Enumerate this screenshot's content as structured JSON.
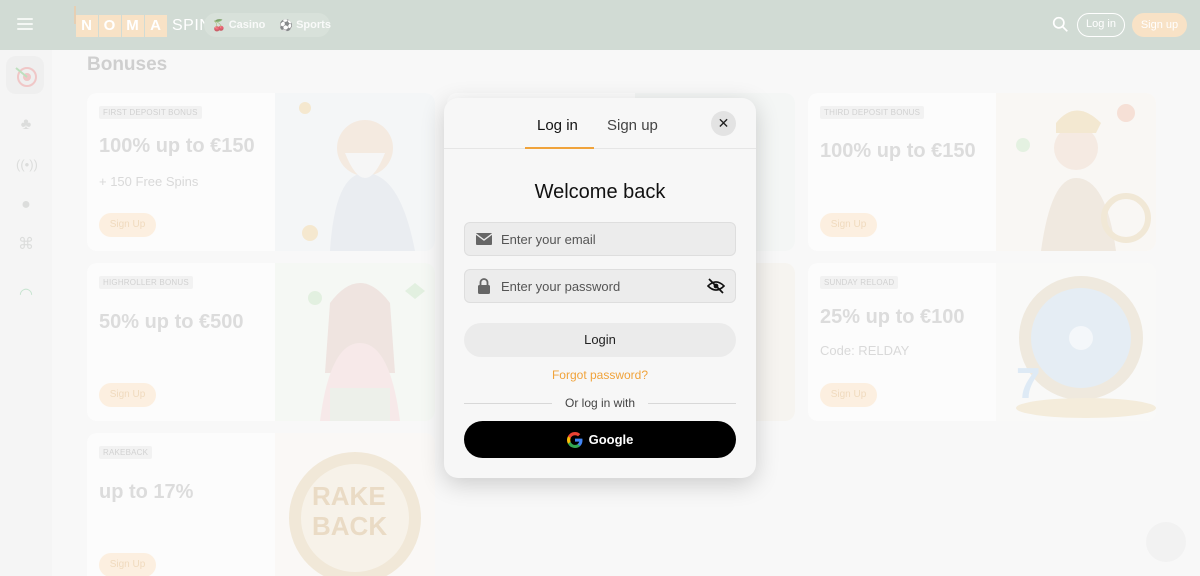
{
  "header": {
    "logo_letters": [
      "N",
      "O",
      "M",
      "A"
    ],
    "logo_suffix": "SPIN",
    "nav": [
      {
        "label": "Casino",
        "icon": "cherry-icon"
      },
      {
        "label": "Sports",
        "icon": "soccer-ball-icon"
      }
    ],
    "login_label": "Log in",
    "signup_label": "Sign up"
  },
  "sidebar": {
    "icons": [
      "dart-target-icon",
      "cherry-icon",
      "live-broadcast-icon",
      "soccer-ball-icon",
      "gamepad-icon",
      "headset-icon"
    ]
  },
  "page": {
    "title": "Bonuses"
  },
  "cards": [
    {
      "tag": "FIRST DEPOSIT BONUS",
      "headline": "100% up to €150",
      "sub": "+ 150 Free Spins",
      "cta": "Sign Up"
    },
    {
      "tag": "THIRD DEPOSIT BONUS",
      "headline": "100% up to €150",
      "sub": "",
      "cta": "Sign Up"
    },
    {
      "tag": "HIGHROLLER BONUS",
      "headline": "50% up to €500",
      "sub": "",
      "cta": "Sign Up"
    },
    {
      "tag": "SUNDAY RELOAD",
      "headline": "25% up to €100",
      "sub": "Code: RELDAY",
      "cta": "Sign Up"
    },
    {
      "tag": "RAKEBACK",
      "headline": "up to 17%",
      "sub": "",
      "cta": "Sign Up"
    }
  ],
  "modal": {
    "tab_login": "Log in",
    "tab_signup": "Sign up",
    "welcome": "Welcome back",
    "email_placeholder": "Enter your email",
    "password_placeholder": "Enter your password",
    "login_button": "Login",
    "forgot": "Forgot password?",
    "divider": "Or log in with",
    "google": "Google"
  },
  "colors": {
    "header_bg": "#b9c8bd",
    "accent_orange": "#f0a33b",
    "logo_peach": "#f4d3a8"
  }
}
